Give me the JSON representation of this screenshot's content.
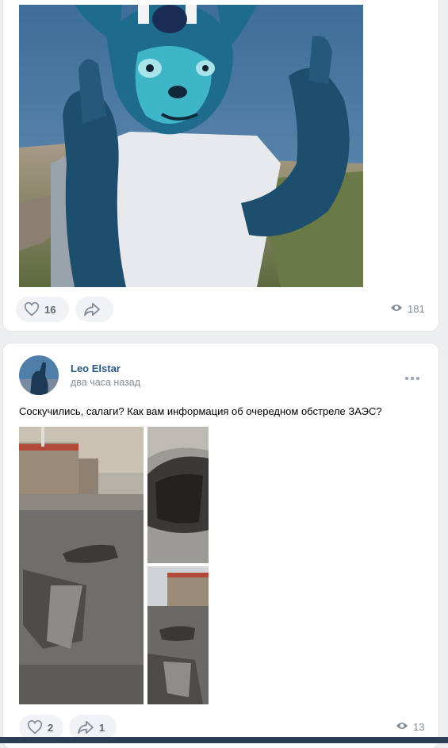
{
  "posts": [
    {
      "image": "furry-costume-photo",
      "likes": "16",
      "shares": "",
      "views": "181"
    },
    {
      "author": "Leo Elstar",
      "time": "два часа назад",
      "text": "Соскучились, салаги? Как вам информация об очередном обстреле ЗАЭС?",
      "images": [
        "zaes-roof-damage-1",
        "zaes-roof-damage-2",
        "zaes-roof-damage-3"
      ],
      "likes": "2",
      "shares": "1",
      "views": "13"
    }
  ],
  "icons": {
    "like": "heart-icon",
    "share": "share-arrow-icon",
    "views": "eye-icon",
    "more": "more-dots-icon"
  },
  "colors": {
    "link": "#2a5885",
    "muted": "#818c99",
    "pill_bg": "#f0f2f5",
    "bottom_bar": "#2d3d54"
  }
}
